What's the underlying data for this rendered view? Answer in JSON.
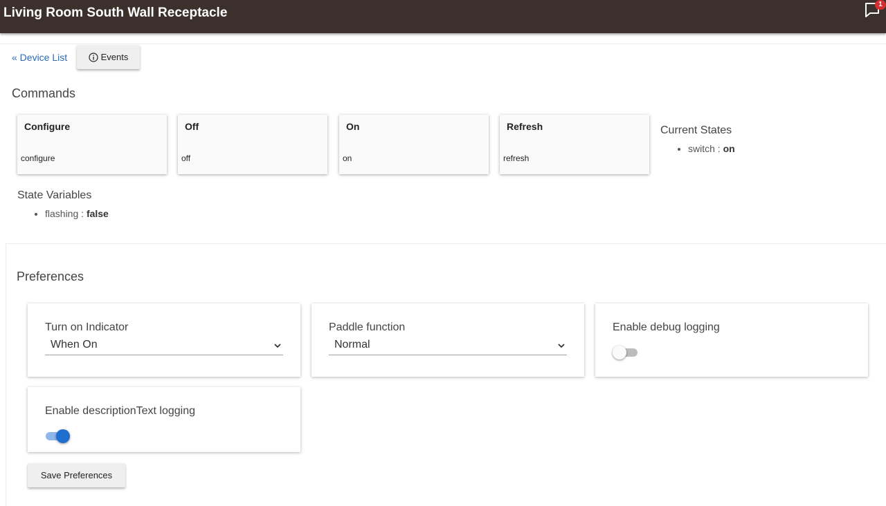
{
  "header": {
    "title": "Living Room South Wall Receptacle",
    "notification_count": "1"
  },
  "nav": {
    "back_link": "« Device List",
    "events_label": "Events"
  },
  "commands": {
    "title": "Commands",
    "items": [
      {
        "label": "Configure",
        "code": "configure"
      },
      {
        "label": "Off",
        "code": "off"
      },
      {
        "label": "On",
        "code": "on"
      },
      {
        "label": "Refresh",
        "code": "refresh"
      }
    ]
  },
  "current_states": {
    "title": "Current States",
    "items": [
      {
        "key": "switch",
        "sep": " : ",
        "value": "on"
      }
    ]
  },
  "state_variables": {
    "title": "State Variables",
    "items": [
      {
        "key": "flashing",
        "sep": " : ",
        "value": "false"
      }
    ]
  },
  "preferences": {
    "title": "Preferences",
    "turn_on_indicator": {
      "label": "Turn on Indicator",
      "selected": "When On"
    },
    "paddle_function": {
      "label": "Paddle function",
      "selected": "Normal"
    },
    "debug_logging": {
      "label": "Enable debug logging",
      "enabled": false
    },
    "description_logging": {
      "label": "Enable descriptionText logging",
      "enabled": true
    },
    "save_label": "Save Preferences"
  },
  "colors": {
    "header_bg": "#3b302b",
    "link": "#2a6ab3",
    "toggle_on": "#1e6fd0",
    "badge": "#d32f2f"
  },
  "icons": {
    "notification": "chat-bubble-icon",
    "info": "info-circle-icon",
    "dropdown": "chevron-down-icon"
  }
}
